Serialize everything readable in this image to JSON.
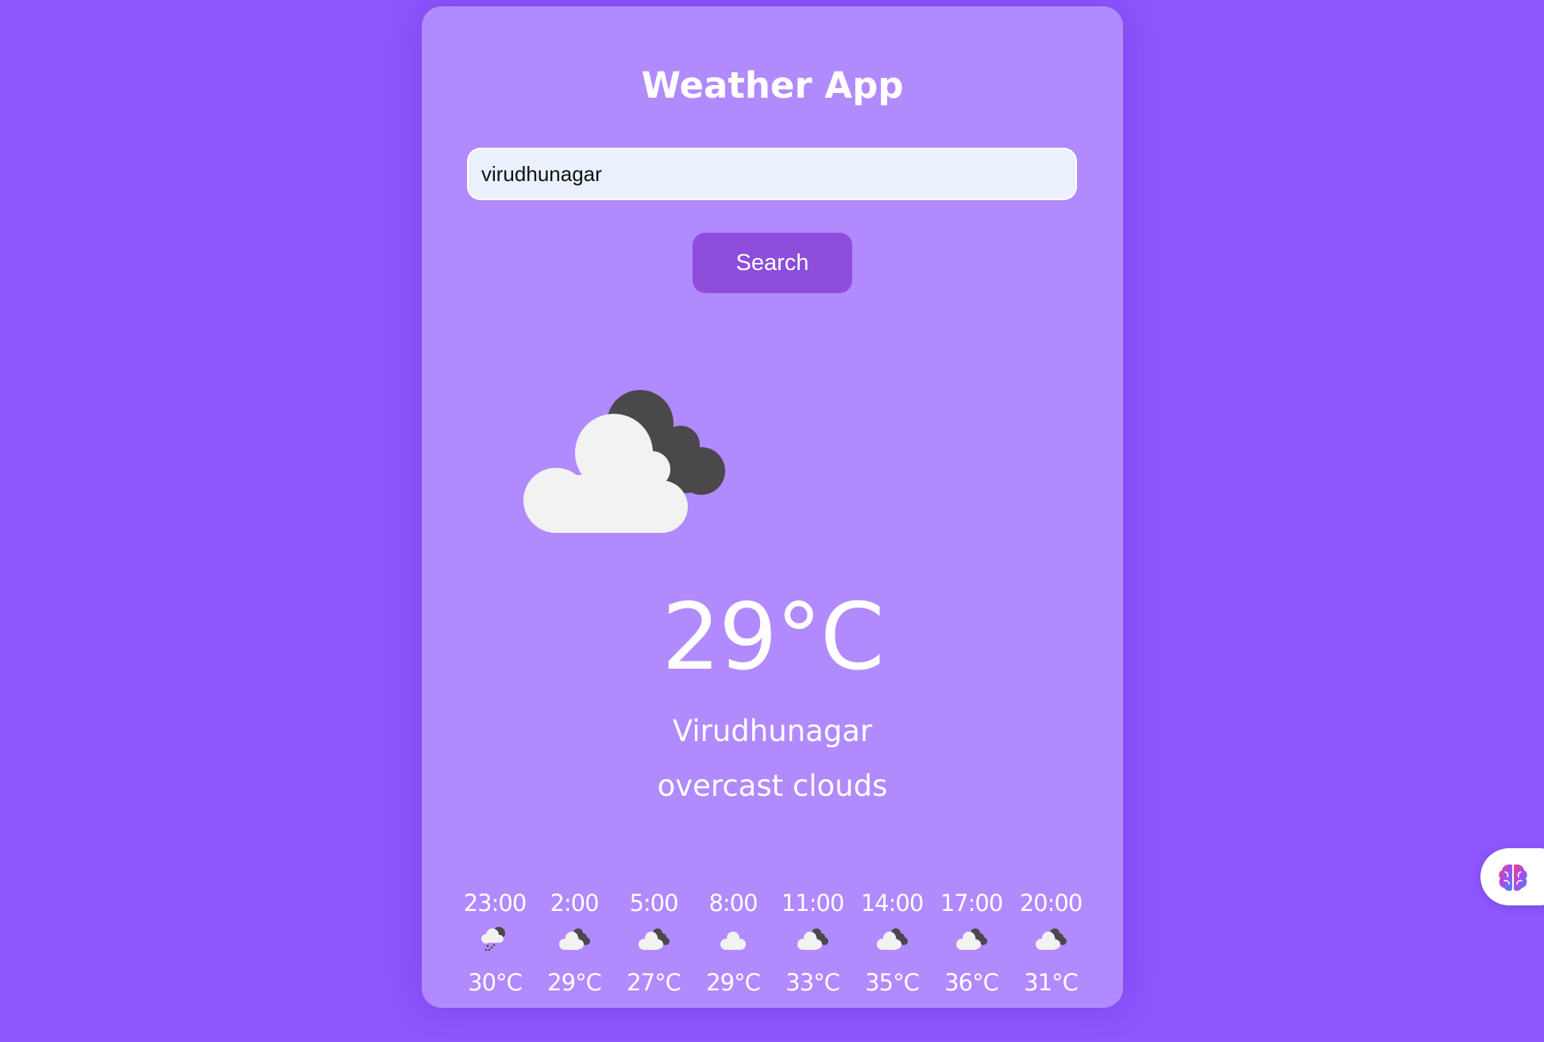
{
  "app": {
    "title": "Weather App"
  },
  "search": {
    "value": "virudhunagar",
    "button_label": "Search"
  },
  "current": {
    "icon": "cloudy-icon",
    "temperature": "29°C",
    "city": "Virudhunagar",
    "description": "overcast clouds"
  },
  "forecast": [
    {
      "time": "23:00",
      "icon": "cloud-rain-icon",
      "temp": "30°C"
    },
    {
      "time": "2:00",
      "icon": "cloudy-icon",
      "temp": "29°C"
    },
    {
      "time": "5:00",
      "icon": "cloudy-icon",
      "temp": "27°C"
    },
    {
      "time": "8:00",
      "icon": "cloud-icon",
      "temp": "29°C"
    },
    {
      "time": "11:00",
      "icon": "cloudy-icon",
      "temp": "33°C"
    },
    {
      "time": "14:00",
      "icon": "cloudy-icon",
      "temp": "35°C"
    },
    {
      "time": "17:00",
      "icon": "cloudy-icon",
      "temp": "36°C"
    },
    {
      "time": "20:00",
      "icon": "cloudy-icon",
      "temp": "31°C"
    }
  ],
  "extension": {
    "icon": "brain-icon"
  },
  "colors": {
    "background": "#8c55fe",
    "card": "#b18afe",
    "button": "#8e4ddb",
    "input": "#eaf0fc"
  }
}
